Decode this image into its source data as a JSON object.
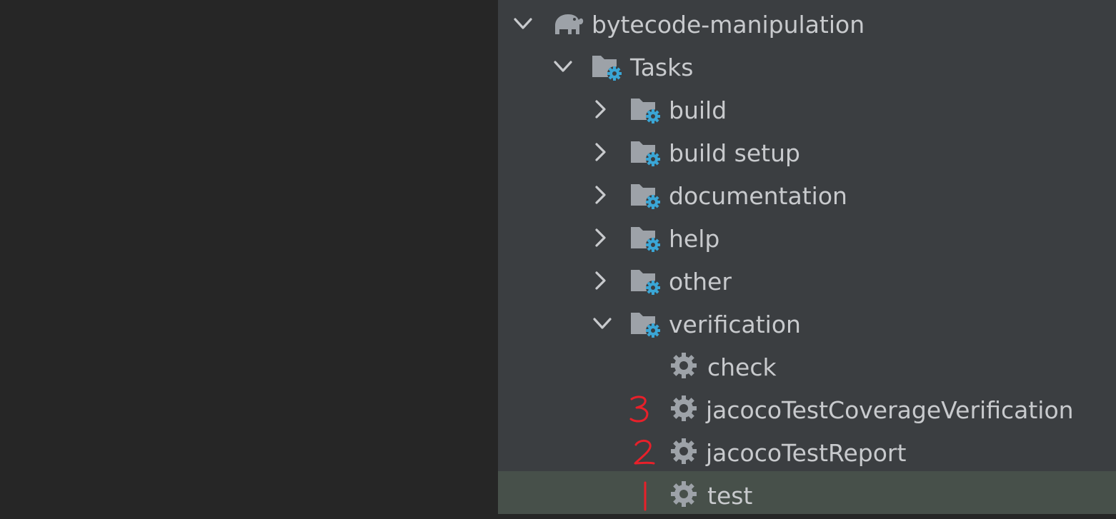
{
  "project": {
    "name": "bytecode-manipulation",
    "icon": "gradle-elephant-icon"
  },
  "tree": {
    "tasks_label": "Tasks",
    "groups": [
      {
        "label": "build",
        "expanded": false
      },
      {
        "label": "build setup",
        "expanded": false
      },
      {
        "label": "documentation",
        "expanded": false
      },
      {
        "label": "help",
        "expanded": false
      },
      {
        "label": "other",
        "expanded": false
      },
      {
        "label": "verification",
        "expanded": true
      }
    ],
    "verification_tasks": [
      {
        "label": "check",
        "annotation": ""
      },
      {
        "label": "jacocoTestCoverageVerification",
        "annotation": "3"
      },
      {
        "label": "jacocoTestReport",
        "annotation": "2"
      },
      {
        "label": "test",
        "annotation": "1",
        "selected": true
      }
    ]
  },
  "colors": {
    "editor_bg": "#262626",
    "panel_bg": "#3b3e41",
    "selected_row": "#47504a",
    "text": "#c8cacd",
    "icon_gray": "#9da2a8",
    "gear_blue": "#3aa6d6",
    "annotation_red": "#e8202a"
  }
}
